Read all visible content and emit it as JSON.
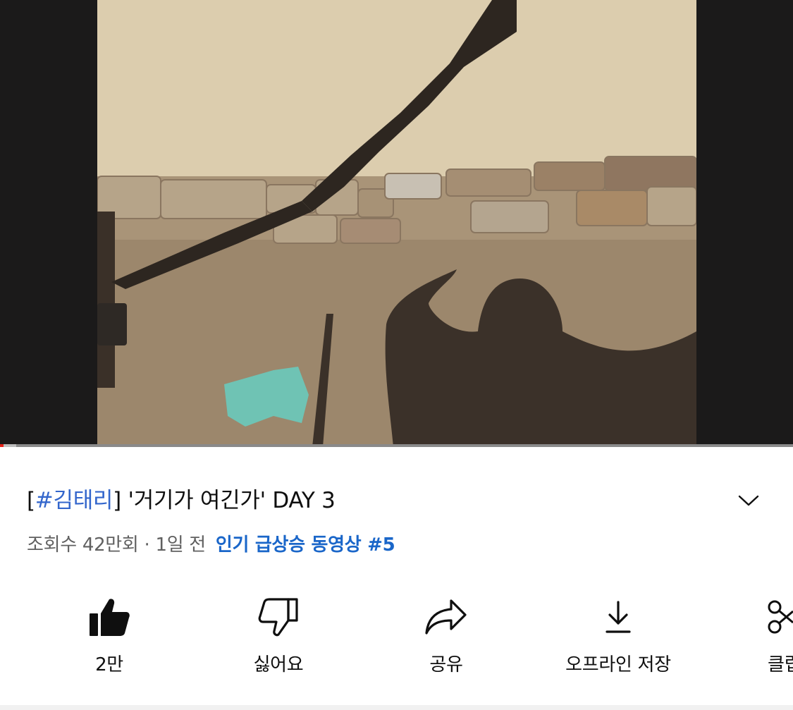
{
  "video": {
    "progress_fraction": 0.004,
    "buffered_fraction": 0.02
  },
  "title": {
    "tag_open": "[",
    "tag": "#김태리",
    "tag_close": "]",
    "text": " '거기가 여긴가' DAY 3"
  },
  "meta": {
    "views": "조회수 42만회",
    "separator": " · ",
    "time": "1일 전",
    "trending": "인기 급상승 동영상 #5"
  },
  "actions": [
    {
      "icon": "thumbs-up-icon",
      "label": "2만"
    },
    {
      "icon": "thumbs-down-icon",
      "label": "싫어요"
    },
    {
      "icon": "share-icon",
      "label": "공유"
    },
    {
      "icon": "download-icon",
      "label": "오프라인 저장"
    },
    {
      "icon": "clip-scissors-icon",
      "label": "클립"
    }
  ],
  "colors": {
    "accent_link": "#1a66c9",
    "hashtag": "#3366cc",
    "progress": "#e62117"
  }
}
